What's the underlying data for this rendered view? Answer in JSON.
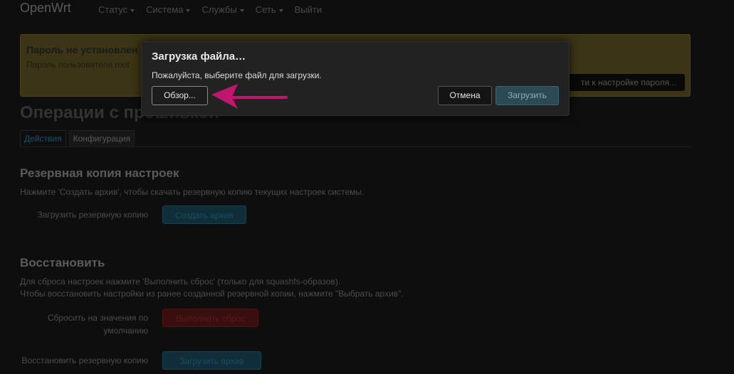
{
  "navbar": {
    "brand": "OpenWrt",
    "items": [
      {
        "label": "Статус",
        "dropdown": true
      },
      {
        "label": "Система",
        "dropdown": true
      },
      {
        "label": "Службы",
        "dropdown": true
      },
      {
        "label": "Сеть",
        "dropdown": true
      },
      {
        "label": "Выйти",
        "dropdown": false
      }
    ]
  },
  "alert": {
    "title": "Пароль не установлен",
    "text": "Пароль пользователя root",
    "button": "ти к настройке пароля..."
  },
  "page": {
    "title": "Операции с прошивкой",
    "tabs": [
      {
        "label": "Действия",
        "active": true
      },
      {
        "label": "Конфигурация",
        "active": false
      }
    ]
  },
  "backup": {
    "title": "Резервная копия настроек",
    "description": "Нажмите 'Создать архив', чтобы скачать резервную копию текущих настроек системы.",
    "label": "Загрузить резервную копию",
    "button": "Создать архив"
  },
  "restore": {
    "title": "Восстановить",
    "description_1": "Для сброса настроек нажмите 'Выполнить сброс' (только для squashfs-образов).",
    "description_2": "Чтобы восстановить настройки из ранее созданной резервной копии, нажмите \"Выбрать архив\".",
    "reset_label": "Сбросить на значения по умолчанию",
    "reset_button": "Выполнить сброс",
    "restore_label": "Восстановить резервную копию",
    "restore_button": "Загрузить архив"
  },
  "modal": {
    "title": "Загрузка файла…",
    "text": "Пожалуйста, выберите файл для загрузки.",
    "browse": "Обзор...",
    "cancel": "Отмена",
    "upload": "Загрузить"
  },
  "colors": {
    "background": "#0e0e0e",
    "modal": "#222222",
    "arrow": "#c0166e",
    "primary": "#2c4a56"
  },
  "icons": {
    "dropdown": "chevron-down-icon",
    "annotation": "arrow-left-icon"
  }
}
